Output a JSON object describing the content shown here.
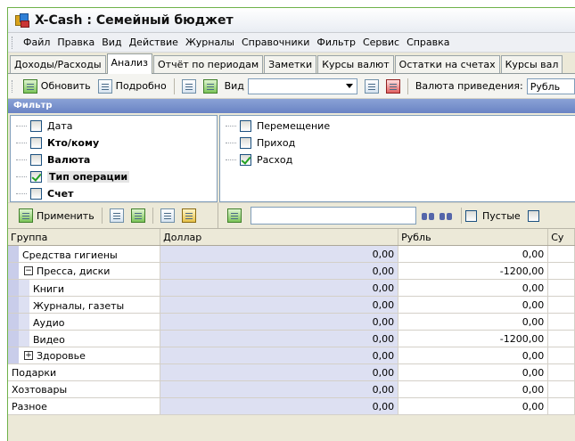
{
  "window": {
    "title": "X-Cash : Семейный бюджет"
  },
  "menu": [
    "Файл",
    "Правка",
    "Вид",
    "Действие",
    "Журналы",
    "Справочники",
    "Фильтр",
    "Сервис",
    "Справка"
  ],
  "tabs": [
    {
      "label": "Доходы/Расходы",
      "active": false
    },
    {
      "label": "Анализ",
      "active": true
    },
    {
      "label": "Отчёт по периодам",
      "active": false
    },
    {
      "label": "Заметки",
      "active": false
    },
    {
      "label": "Курсы валют",
      "active": false
    },
    {
      "label": "Остатки на счетах",
      "active": false
    },
    {
      "label": "Курсы вал",
      "active": false
    }
  ],
  "toolbar": {
    "refresh_label": "Обновить",
    "detail_label": "Подробно",
    "view_label": "Вид",
    "currency_label": "Валюта приведения:",
    "currency_value": "Рубль"
  },
  "filter": {
    "header": "Фильтр",
    "left_items": [
      {
        "label": "Дата",
        "checked": false,
        "bold": false
      },
      {
        "label": "Кто/кому",
        "checked": false,
        "bold": true
      },
      {
        "label": "Валюта",
        "checked": false,
        "bold": true
      },
      {
        "label": "Тип операции",
        "checked": true,
        "bold": true
      },
      {
        "label": "Счет",
        "checked": false,
        "bold": true
      }
    ],
    "right_items": [
      {
        "label": "Перемещение",
        "checked": false
      },
      {
        "label": "Приход",
        "checked": false
      },
      {
        "label": "Расход",
        "checked": true
      }
    ],
    "apply_label": "Применить",
    "search_value": "",
    "empty_label": "Пустые"
  },
  "grid": {
    "columns": [
      "Группа",
      "Доллар",
      "Рубль",
      "Су"
    ],
    "rows": [
      {
        "group": "Средства гигиены",
        "level": 1,
        "expander": "",
        "usd": "0,00",
        "rub": "0,00"
      },
      {
        "group": "Пресса, диски",
        "level": 1,
        "expander": "−",
        "usd": "0,00",
        "rub": "-1200,00"
      },
      {
        "group": "Книги",
        "level": 2,
        "expander": "",
        "usd": "0,00",
        "rub": "0,00"
      },
      {
        "group": "Журналы, газеты",
        "level": 2,
        "expander": "",
        "usd": "0,00",
        "rub": "0,00"
      },
      {
        "group": "Аудио",
        "level": 2,
        "expander": "",
        "usd": "0,00",
        "rub": "0,00"
      },
      {
        "group": "Видео",
        "level": 2,
        "expander": "",
        "usd": "0,00",
        "rub": "-1200,00"
      },
      {
        "group": "Здоровье",
        "level": 1,
        "expander": "+",
        "usd": "0,00",
        "rub": "0,00"
      },
      {
        "group": "Подарки",
        "level": 0,
        "expander": "",
        "usd": "0,00",
        "rub": "0,00"
      },
      {
        "group": "Хозтовары",
        "level": 0,
        "expander": "",
        "usd": "0,00",
        "rub": "0,00"
      },
      {
        "group": "Разное",
        "level": 0,
        "expander": "",
        "usd": "0,00",
        "rub": "0,00"
      }
    ]
  }
}
